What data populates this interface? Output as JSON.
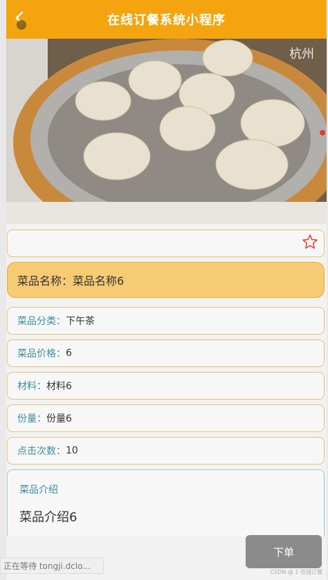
{
  "header": {
    "title": "在线订餐系统小程序"
  },
  "hero": {
    "image": "xiaolongbao-dumplings-in-bamboo-steamer",
    "brand_text": "杭州"
  },
  "favorite": {
    "icon": "star-outline-icon",
    "color": "#e0453a"
  },
  "dish": {
    "name_label": "菜品名称：",
    "name_value": "菜品名称6",
    "fields": [
      {
        "label": "菜品分类：",
        "value": "下午茶"
      },
      {
        "label": "菜品价格：",
        "value": "6"
      },
      {
        "label": "材料：",
        "value": "材料6"
      },
      {
        "label": "份量：",
        "value": "份量6"
      },
      {
        "label": "点击次数：",
        "value": "10"
      }
    ],
    "intro_label": "菜品介绍",
    "intro_text": "菜品介绍6"
  },
  "actions": {
    "order_label": "下单"
  },
  "status": {
    "loading_text": "正在等待 tongji.dclo..."
  },
  "watermark": "CSDN @ 1 在线订餐",
  "colors": {
    "header": "#f4a40f",
    "name_bg": "#f7cb74",
    "label": "#3b8f9a",
    "button": "#8b8b8b"
  }
}
